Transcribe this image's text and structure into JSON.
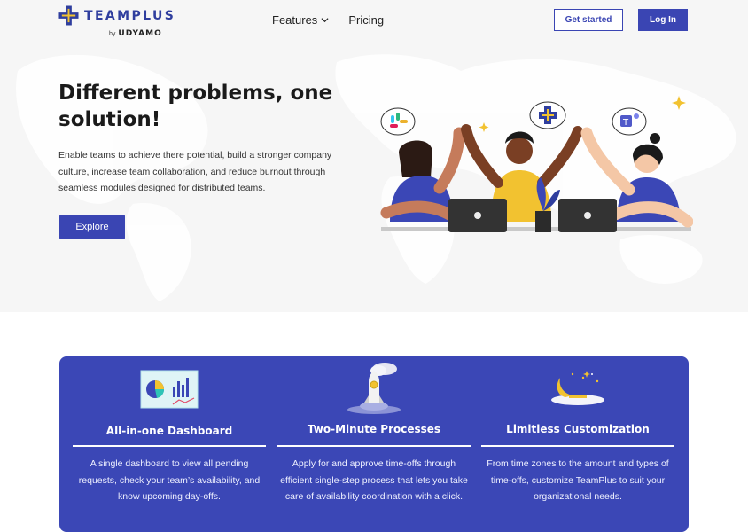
{
  "brand": {
    "name": "TEAMPLUS",
    "by_prefix": "by",
    "by_name": "UDYAMO"
  },
  "nav": {
    "features": "Features",
    "pricing": "Pricing"
  },
  "header": {
    "get_started": "Get started",
    "login": "Log In"
  },
  "hero": {
    "title": "Different problems, one solution!",
    "description": "Enable teams to achieve there potential, build a stronger company culture, increase team collaboration, and reduce burnout through seamless modules designed for distributed teams.",
    "cta": "Explore"
  },
  "features": [
    {
      "icon": "dashboard-chart-icon",
      "title": "All-in-one Dashboard",
      "description": "A single dashboard to view all pending requests, check your team’s availability, and know upcoming day-offs."
    },
    {
      "icon": "rocket-icon",
      "title": "Two-Minute Processes",
      "description": "Apply for and approve time-offs through efficient single-step process that lets you take care of availability coordination with a click."
    },
    {
      "icon": "moon-night-icon",
      "title": "Limitless Customization",
      "description": "From time zones to the amount and types of time-offs, customize TeamPlus to suit your organizational needs."
    }
  ],
  "colors": {
    "primary": "#3a45b3",
    "panel": "#3b47b6",
    "hero_bg": "#f6f6f6"
  }
}
